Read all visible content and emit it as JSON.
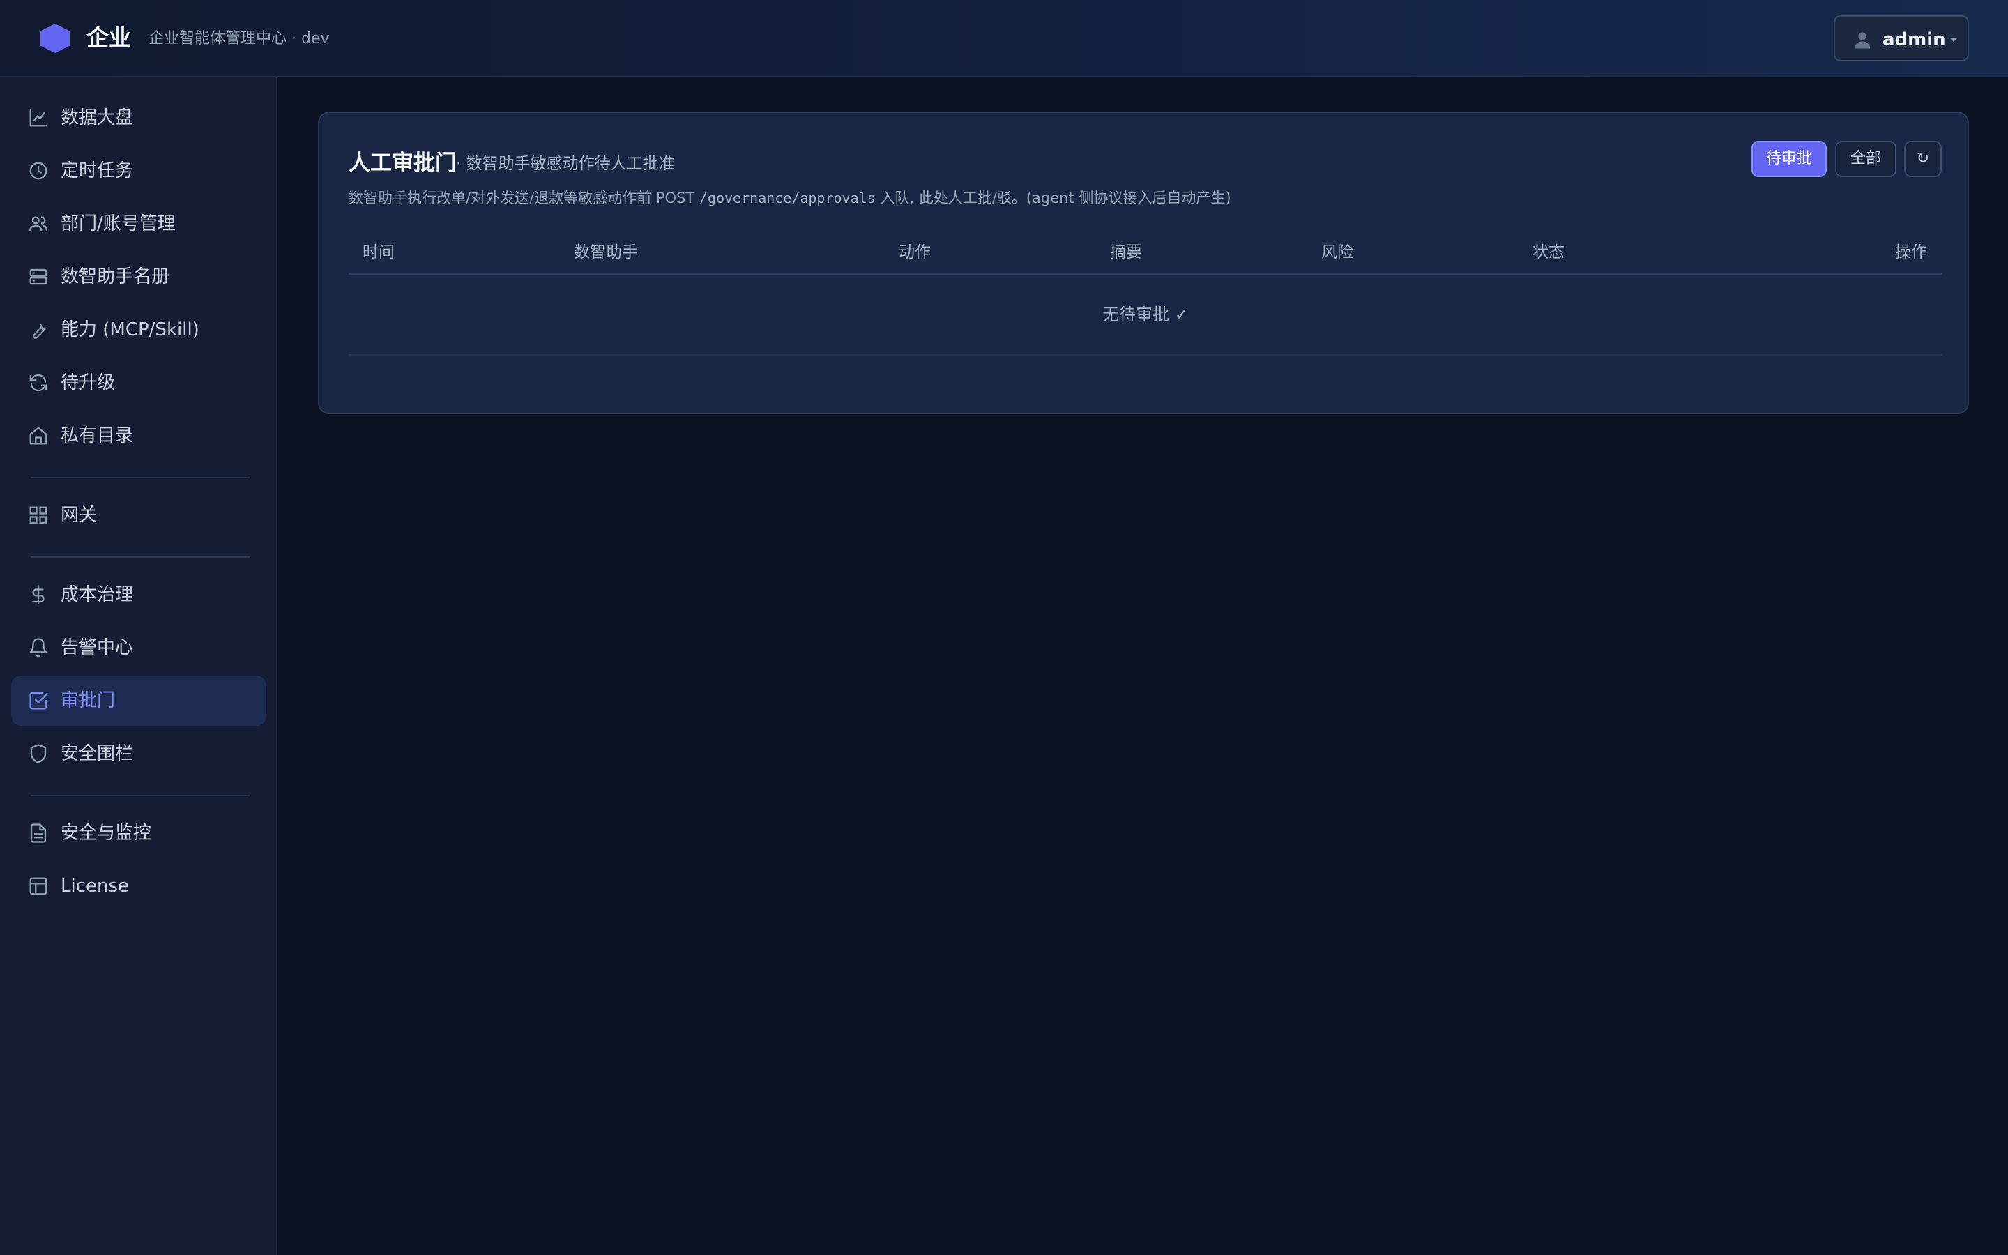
{
  "header": {
    "brand": "企业",
    "subtitle": "企业智能体管理中心 · dev",
    "user": {
      "name": "admin",
      "icon": "user-icon"
    }
  },
  "sidebar": {
    "items": [
      {
        "label": "数据大盘",
        "icon": "chart-line-icon"
      },
      {
        "label": "定时任务",
        "icon": "clock-icon"
      },
      {
        "label": "部门/账号管理",
        "icon": "users-icon"
      },
      {
        "label": "数智助手名册",
        "icon": "server-icon"
      },
      {
        "label": "能力 (MCP/Skill)",
        "icon": "wrench-icon"
      },
      {
        "label": "待升级",
        "icon": "refresh-icon"
      },
      {
        "label": "私有目录",
        "icon": "home-icon"
      },
      {
        "label": "网关",
        "icon": "grid-icon"
      },
      {
        "label": "成本治理",
        "icon": "dollar-icon"
      },
      {
        "label": "告警中心",
        "icon": "bell-icon"
      },
      {
        "label": "审批门",
        "icon": "check-square-icon",
        "active": true
      },
      {
        "label": "安全围栏",
        "icon": "shield-icon"
      },
      {
        "label": "安全与监控",
        "icon": "file-text-icon"
      },
      {
        "label": "License",
        "icon": "layout-icon"
      }
    ]
  },
  "card": {
    "title": "人工审批门",
    "subtitle": "· 数智助手敏感动作待人工批准",
    "desc_prefix": "数智助手执行改单/对外发送/退款等敏感动作前 POST ",
    "desc_code": "/governance/approvals",
    "desc_suffix": " 入队, 此处人工批/驳。(agent 侧协议接入后自动产生)",
    "buttons": {
      "pending": "待审批",
      "all": "全部",
      "refresh": "↻"
    },
    "columns": [
      "时间",
      "数智助手",
      "动作",
      "摘要",
      "风险",
      "状态",
      "操作"
    ],
    "empty": "无待审批 ✓"
  },
  "colors": {
    "accent": "#6366f1",
    "active_text": "#818cf8",
    "background": "#0b1120",
    "sidebar": "#141d33",
    "card": "#1a2744"
  }
}
